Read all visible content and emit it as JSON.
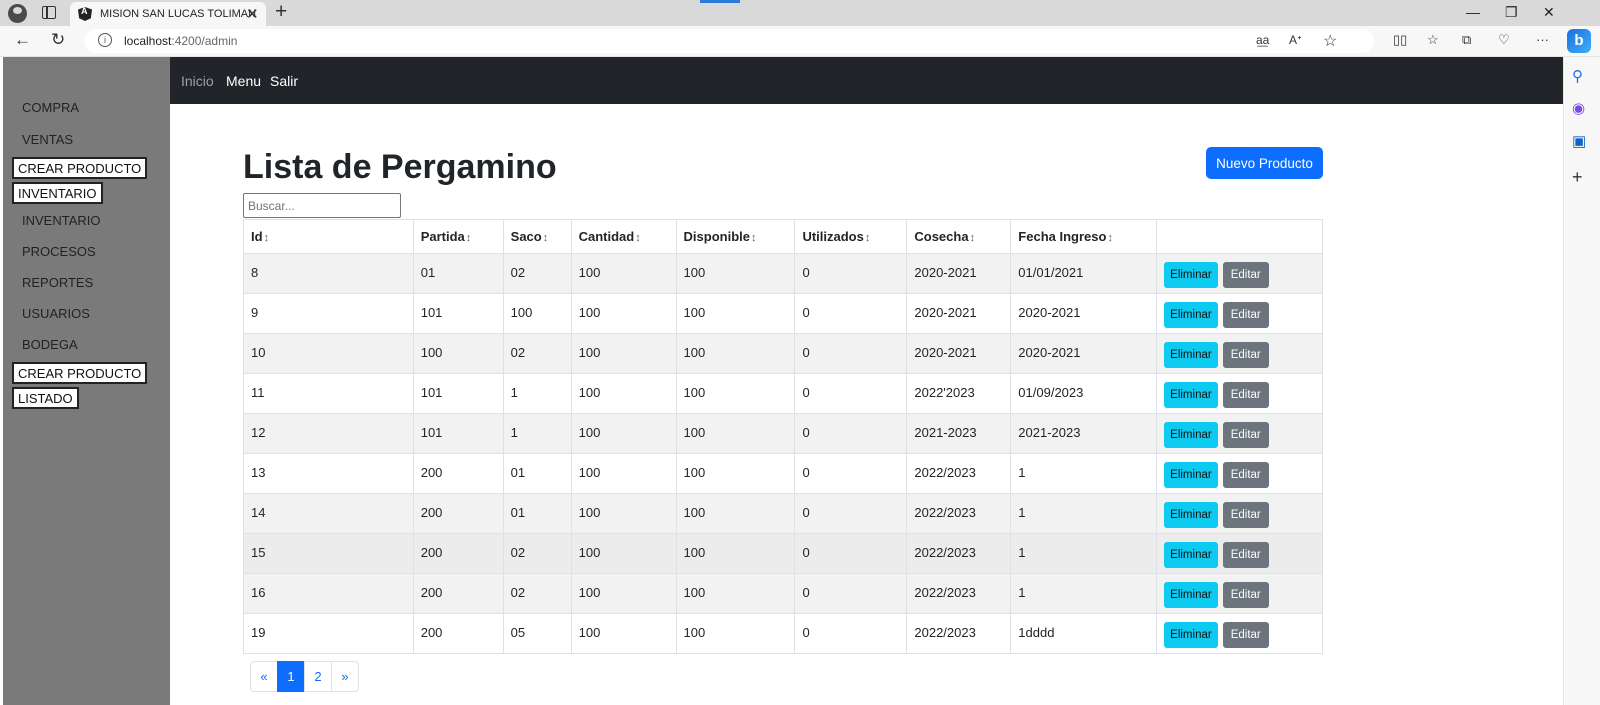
{
  "browser": {
    "tab_title": "MISION SAN LUCAS TOLIMAN",
    "url_host": "localhost",
    "url_rest": ":4200/admin"
  },
  "sidebar": {
    "items": [
      {
        "label": "COMPRA",
        "type": "link"
      },
      {
        "label": "VENTAS",
        "type": "link"
      },
      {
        "label": "CREAR PRODUCTO",
        "type": "button"
      },
      {
        "label": "INVENTARIO",
        "type": "button"
      },
      {
        "label": "INVENTARIO",
        "type": "link"
      },
      {
        "label": "PROCESOS",
        "type": "link"
      },
      {
        "label": "REPORTES",
        "type": "link"
      },
      {
        "label": "USUARIOS",
        "type": "link"
      },
      {
        "label": "BODEGA",
        "type": "link"
      },
      {
        "label": "CREAR PRODUCTO",
        "type": "button"
      },
      {
        "label": "LISTADO",
        "type": "button"
      }
    ]
  },
  "topnav": {
    "inicio": "Inicio",
    "menu": "Menu",
    "salir": "Salir"
  },
  "main": {
    "title": "Lista de Pergamino",
    "new_button": "Nuevo Producto",
    "search_placeholder": "Buscar...",
    "sort_glyph": "↕",
    "columns": [
      "Id",
      "Partida",
      "Saco",
      "Cantidad",
      "Disponible",
      "Utilizados",
      "Cosecha",
      "Fecha Ingreso",
      ""
    ],
    "actions": {
      "delete": "Eliminar",
      "edit": "Editar"
    },
    "rows": [
      [
        "8",
        "01",
        "02",
        "100",
        "100",
        "0",
        "2020-2021",
        "01/01/2021"
      ],
      [
        "9",
        "101",
        "100",
        "100",
        "100",
        "0",
        "2020-2021",
        "2020-2021"
      ],
      [
        "10",
        "100",
        "02",
        "100",
        "100",
        "0",
        "2020-2021",
        "2020-2021"
      ],
      [
        "11",
        "101",
        "1",
        "100",
        "100",
        "0",
        "2022'2023",
        "01/09/2023"
      ],
      [
        "12",
        "101",
        "1",
        "100",
        "100",
        "0",
        "2021-2023",
        "2021-2023"
      ],
      [
        "13",
        "200",
        "01",
        "100",
        "100",
        "0",
        "2022/2023",
        "1"
      ],
      [
        "14",
        "200",
        "01",
        "100",
        "100",
        "0",
        "2022/2023",
        "1"
      ],
      [
        "15",
        "200",
        "02",
        "100",
        "100",
        "0",
        "2022/2023",
        "1"
      ],
      [
        "16",
        "200",
        "02",
        "100",
        "100",
        "0",
        "2022/2023",
        "1"
      ],
      [
        "19",
        "200",
        "05",
        "100",
        "100",
        "0",
        "2022/2023",
        "1dddd"
      ]
    ],
    "pagination": [
      "«",
      "1",
      "2",
      "»"
    ],
    "current_page": "1"
  }
}
